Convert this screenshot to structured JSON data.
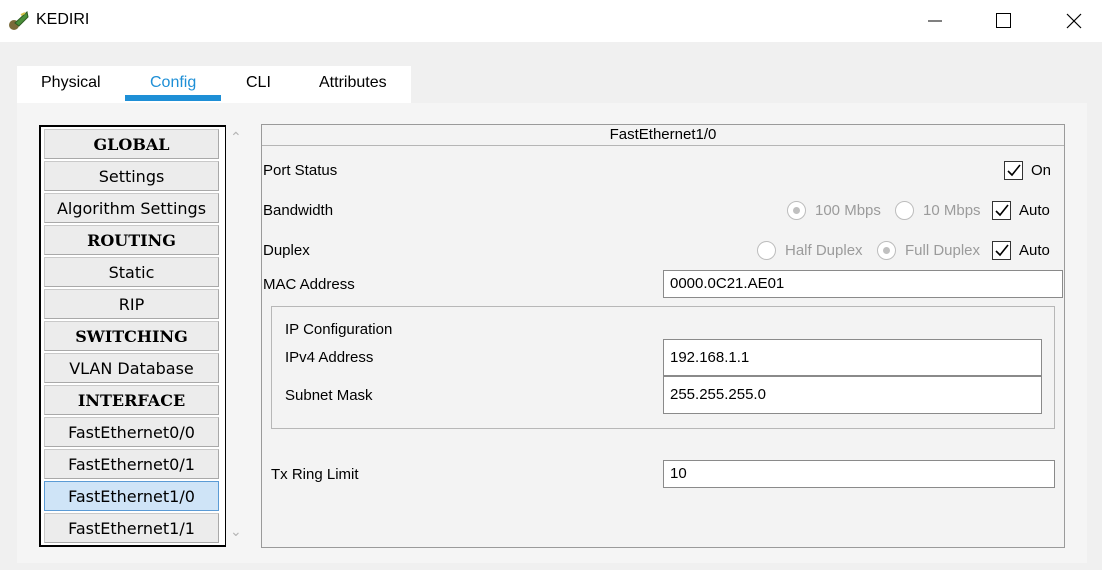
{
  "window": {
    "title": "KEDIRI"
  },
  "tabs": [
    {
      "label": "Physical"
    },
    {
      "label": "Config"
    },
    {
      "label": "CLI"
    },
    {
      "label": "Attributes"
    }
  ],
  "active_tab": "Config",
  "nav": {
    "items": [
      {
        "label": "GLOBAL",
        "type": "header"
      },
      {
        "label": "Settings",
        "type": "item"
      },
      {
        "label": "Algorithm Settings",
        "type": "item"
      },
      {
        "label": "ROUTING",
        "type": "header"
      },
      {
        "label": "Static",
        "type": "item"
      },
      {
        "label": "RIP",
        "type": "item"
      },
      {
        "label": "SWITCHING",
        "type": "header"
      },
      {
        "label": "VLAN Database",
        "type": "item"
      },
      {
        "label": "INTERFACE",
        "type": "header"
      },
      {
        "label": "FastEthernet0/0",
        "type": "item"
      },
      {
        "label": "FastEthernet0/1",
        "type": "item"
      },
      {
        "label": "FastEthernet1/0",
        "type": "item",
        "selected": true
      },
      {
        "label": "FastEthernet1/1",
        "type": "item"
      }
    ]
  },
  "panel": {
    "title": "FastEthernet1/0",
    "port_status": {
      "label": "Port Status",
      "on_label": "On",
      "on_checked": true
    },
    "bandwidth": {
      "label": "Bandwidth",
      "opt1": "100 Mbps",
      "opt2": "10 Mbps",
      "selected": "100 Mbps",
      "auto_label": "Auto",
      "auto_checked": true
    },
    "duplex": {
      "label": "Duplex",
      "opt1": "Half Duplex",
      "opt2": "Full Duplex",
      "selected": "Full Duplex",
      "auto_label": "Auto",
      "auto_checked": true
    },
    "mac": {
      "label": "MAC Address",
      "value": "0000.0C21.AE01"
    },
    "ip_config": {
      "title": "IP Configuration",
      "ipv4_label": "IPv4 Address",
      "ipv4_value": "192.168.1.1",
      "mask_label": "Subnet Mask",
      "mask_value": "255.255.255.0"
    },
    "tx_ring": {
      "label": "Tx Ring Limit",
      "value": "10"
    }
  },
  "colors": {
    "accent": "#1e8fd6",
    "selected_item_bg": "#cfe4f7"
  }
}
